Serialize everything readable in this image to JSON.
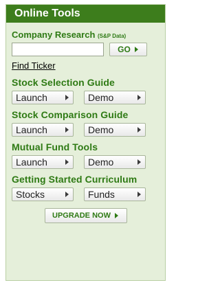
{
  "header": {
    "title": "Online Tools"
  },
  "company_research": {
    "title": "Company Research",
    "subtitle": "(S&P Data)",
    "search_value": "",
    "go_label": "GO",
    "find_ticker_label": "Find Ticker"
  },
  "sections": [
    {
      "title": "Stock Selection Guide",
      "left_button": "Launch",
      "right_button": "Demo"
    },
    {
      "title": "Stock Comparison Guide",
      "left_button": "Launch",
      "right_button": "Demo"
    },
    {
      "title": "Mutual Fund Tools",
      "left_button": "Launch",
      "right_button": "Demo"
    },
    {
      "title": "Getting Started Curriculum",
      "left_button": "Stocks",
      "right_button": "Funds"
    }
  ],
  "upgrade": {
    "label": "UPGRADE NOW"
  },
  "colors": {
    "header_bg": "#3d7d1c",
    "panel_bg": "#e5efda",
    "title_green": "#2e7a14"
  },
  "icons": {
    "button_arrow": "triangle-right-icon"
  }
}
